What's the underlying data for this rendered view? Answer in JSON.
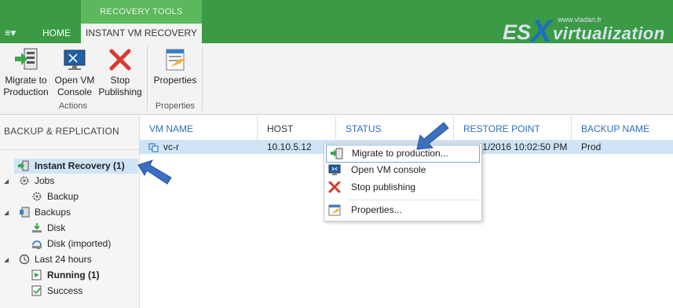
{
  "ribbon": {
    "context_group": "RECOVERY TOOLS",
    "menu_glyph": "≡▾",
    "tabs": {
      "home": "HOME",
      "active": "INSTANT VM RECOVERY"
    },
    "buttons": {
      "migrate": "Migrate to\nProduction",
      "console": "Open VM\nConsole",
      "stop": "Stop\nPublishing",
      "properties": "Properties"
    },
    "groups": {
      "actions": "Actions",
      "properties": "Properties"
    }
  },
  "logo": {
    "es": "ES",
    "x": "X",
    "virt": "virtualization",
    "www": "www.vladan.fr"
  },
  "nav": {
    "title": "BACKUP & REPLICATION",
    "items": {
      "instant_recovery": "Instant Recovery (1)",
      "jobs": "Jobs",
      "backup": "Backup",
      "backups": "Backups",
      "disk": "Disk",
      "disk_imported": "Disk (imported)",
      "last24": "Last 24 hours",
      "running": "Running (1)",
      "success": "Success"
    }
  },
  "grid": {
    "columns": {
      "vm_name": "VM NAME",
      "host": "HOST",
      "status": "STATUS",
      "restore_point": "RESTORE POINT",
      "backup_name": "BACKUP NAME"
    },
    "rows": [
      {
        "vm_name": "vc-r",
        "host": "10.10.5.12",
        "restore_point": "/1/2016 10:02:50 PM",
        "backup_name": "Prod"
      }
    ]
  },
  "context_menu": {
    "items": {
      "migrate": "Migrate to production...",
      "console": "Open VM console",
      "stop": "Stop publishing",
      "properties": "Properties..."
    }
  },
  "colors": {
    "accent": "#3a9a46",
    "context_tab": "#5cb85c",
    "selection": "#cfe4f7",
    "header_text": "#2e6fbf",
    "arrow": "#3b6fc2"
  }
}
